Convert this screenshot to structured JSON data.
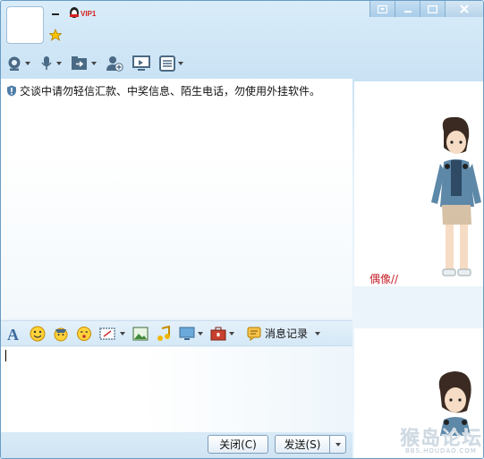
{
  "header": {
    "nickname_dash": "–",
    "vip_badge": "VIP1"
  },
  "toolbar": {
    "items": [
      {
        "name": "video-call-icon",
        "has_menu": true
      },
      {
        "name": "voice-call-icon",
        "has_menu": true
      },
      {
        "name": "send-file-icon",
        "has_menu": true
      },
      {
        "name": "add-contact-icon",
        "has_menu": false
      },
      {
        "name": "remote-desktop-icon",
        "has_menu": false
      },
      {
        "name": "app-menu-icon",
        "has_menu": true
      }
    ]
  },
  "window_buttons": [
    "menu-icon",
    "minimize-icon",
    "maximize-icon",
    "close-icon"
  ],
  "message": {
    "notice": "交谈中请勿轻信汇款、中奖信息、陌生电话，勿使用外挂软件。"
  },
  "show_panel": {
    "caption": "偶像//"
  },
  "format_bar": {
    "history_label": "消息记录"
  },
  "bottom": {
    "close_label": "关闭(C)",
    "send_label": "发送(S)"
  },
  "watermark": {
    "text": "猴岛论坛",
    "url": "BBS.HOUDAO.COM"
  },
  "colors": {
    "accent": "#6a9cc4",
    "caption_red": "#c4202a"
  }
}
